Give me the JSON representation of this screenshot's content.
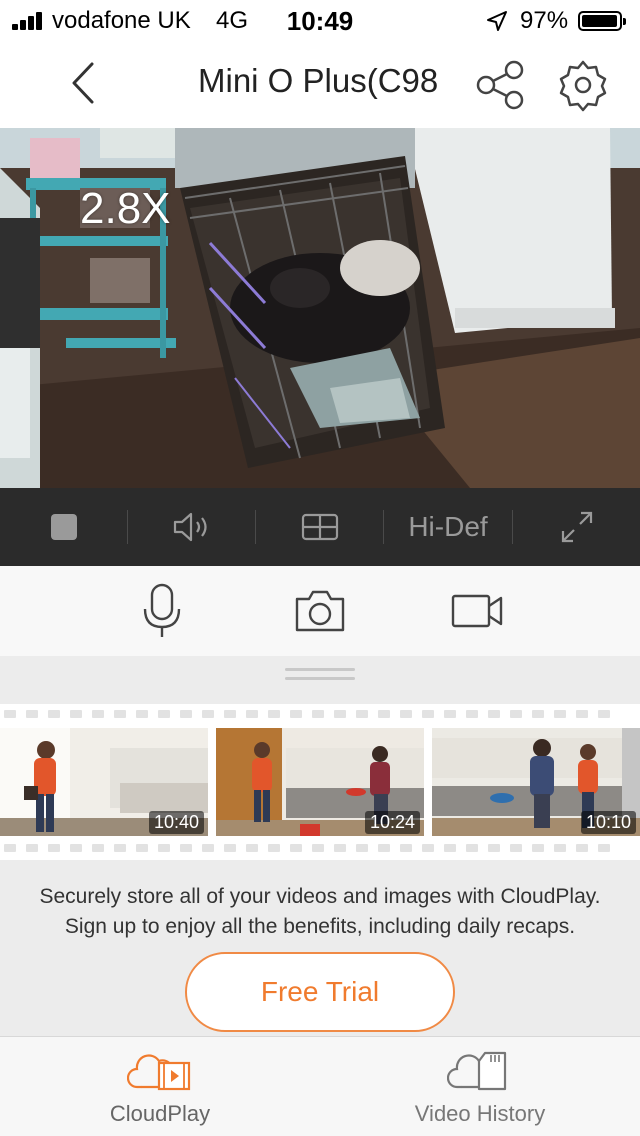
{
  "status_bar": {
    "carrier": "vodafone UK",
    "network": "4G",
    "time": "10:49",
    "battery_percent": "97%",
    "battery_level": 0.97
  },
  "nav": {
    "title": "Mini O Plus(C98"
  },
  "video": {
    "zoom": "2.8X"
  },
  "video_controls": {
    "quality_label": "Hi-Def"
  },
  "filmstrip": {
    "clips": [
      {
        "time": "10:40"
      },
      {
        "time": "10:24"
      },
      {
        "time": "10:10"
      }
    ]
  },
  "promo": {
    "line1": "Securely store all of your videos and images with CloudPlay.",
    "line2": "Sign up to enjoy all the benefits, including daily recaps.",
    "button_label": "Free Trial"
  },
  "tabs": [
    {
      "label": "CloudPlay",
      "active": true,
      "icon": "cloud-film-icon"
    },
    {
      "label": "Video History",
      "active": false,
      "icon": "cloud-sdcard-icon"
    }
  ],
  "colors": {
    "accent": "#f07b2e",
    "control_bar": "#2b2b2b"
  }
}
